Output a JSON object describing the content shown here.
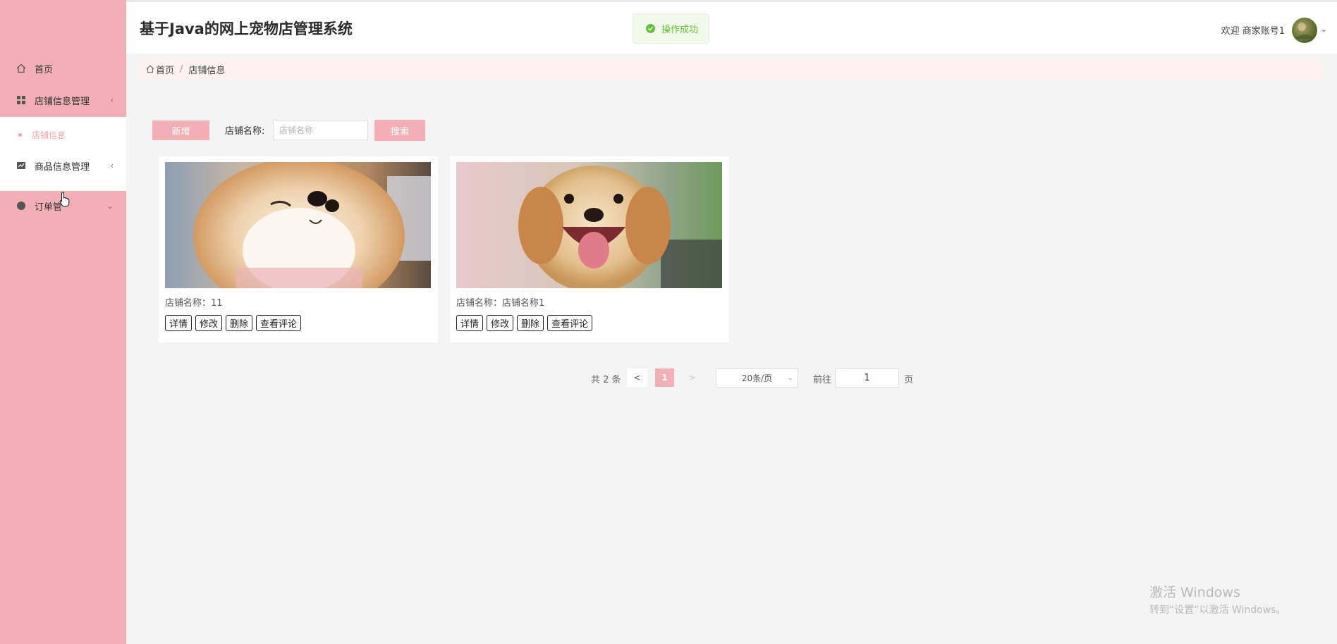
{
  "header": {
    "app_title": "基于Java的网上宠物店管理系统",
    "toast": "操作成功",
    "welcome": "欢迎 商家账号1"
  },
  "sidebar": {
    "items": [
      {
        "label": "首页",
        "icon": "home-icon"
      },
      {
        "label": "店铺信息管理",
        "icon": "grid-icon",
        "arrow": "‹"
      },
      {
        "label": "店铺信息",
        "icon": "dot",
        "sub": true
      },
      {
        "label": "商品信息管理",
        "icon": "chart-icon",
        "arrow": "‹"
      },
      {
        "label": "订单管",
        "icon": "order-icon",
        "arrow": "⌄"
      }
    ]
  },
  "breadcrumb": {
    "home": "首页",
    "separator": "/",
    "current": "店铺信息"
  },
  "toolbar": {
    "new_label": "新增",
    "search_label": "店铺名称:",
    "search_placeholder": "店铺名称",
    "search_button": "搜索"
  },
  "cards": [
    {
      "name": "店铺名称：11",
      "image": "shiba-dog-photo"
    },
    {
      "name": "店铺名称：店铺名称1",
      "image": "golden-retriever-photo"
    }
  ],
  "card_actions": {
    "detail": "详情",
    "edit": "修改",
    "delete": "删除",
    "comments": "查看评论"
  },
  "pagination": {
    "total": "共 2 条",
    "prev": "<",
    "current_page": "1",
    "next": ">",
    "page_size": "20条/页",
    "goto_label": "前往",
    "goto_value": "1",
    "page_suffix": "页"
  },
  "watermark": {
    "title": "激活 Windows",
    "subtitle": "转到“设置”以激活 Windows。"
  },
  "colors": {
    "sidebar": "#f2b0b6",
    "primary": "#f2b0b6",
    "success": "#67c23a"
  }
}
